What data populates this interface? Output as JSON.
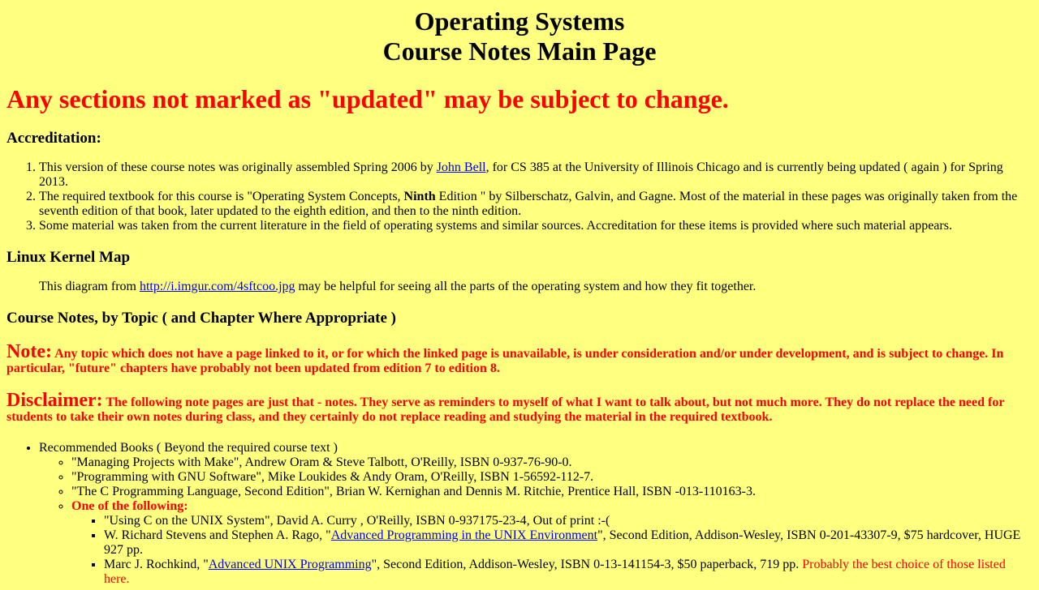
{
  "header": {
    "title_line1": "Operating Systems",
    "title_line2": "Course Notes Main Page"
  },
  "warning": "Any sections not marked as \"updated\" may be subject to change.",
  "accreditation": {
    "heading": "Accreditation:",
    "items": [
      {
        "text_before": "This version of these course notes was originally assembled Spring 2006 by ",
        "link": "John Bell",
        "text_after": ", for CS 385 at the University of Illinois Chicago and is currently being updated ( again ) for Spring 2013."
      },
      {
        "text_before": "The required textbook for this course is \"Operating System Concepts, ",
        "bold": "Ninth",
        "text_after": " Edition \" by Silberschatz, Galvin, and Gagne. Most of the material in these pages was originally taken from the seventh edition of that book, later updated to the eighth edition, and then to the ninth edition."
      },
      {
        "text": "Some material was taken from the current literature in the field of operating systems and similar sources. Accreditation for these items is provided where such material appears."
      }
    ]
  },
  "kernel_map": {
    "heading": "Linux Kernel Map",
    "text_before": "This diagram from ",
    "link": "http://i.imgur.com/4sftcoo.jpg",
    "text_after": " may be helpful for seeing all the parts of the operating system and how they fit together."
  },
  "course_notes": {
    "heading": "Course Notes, by Topic ( and Chapter Where Appropriate )"
  },
  "note": {
    "label": "Note:",
    "text": " Any topic which does not have a page linked to it, or for which the linked page is unavailable, is under consideration and/or under development, and is subject to change. In particular, \"future\" chapters have probably not been updated from edition 7 to edition 8."
  },
  "disclaimer": {
    "label": "Disclaimer:",
    "text": " The following note pages are just that - notes. They serve as reminders to myself of what I want to talk about, but not much more. They do not replace the need for students to take their own notes during class, and they certainly do not replace reading and studying the material in the required textbook."
  },
  "books": {
    "heading": "Recommended Books ( Beyond the required course text )",
    "items": [
      "\"Managing Projects with Make\", Andrew Oram & Steve Talbott, O'Reilly, ISBN 0-937-76-90-0.",
      "\"Programming with GNU Software\", Mike Loukides & Andy Oram, O'Reilly, ISBN 1-56592-112-7.",
      "\"The C Programming Language, Second Edition\", Brian W. Kernighan and Dennis M. Ritchie, Prentice Hall, ISBN -013-110163-3."
    ],
    "one_of_label": "One of the following:",
    "sub": {
      "item1": "\"Using C on the UNIX System\", David A. Curry , O'Reilly, ISBN 0-937175-23-4, Out of print :-(",
      "item2_before": "W. Richard Stevens and Stephen A. Rago, \"",
      "item2_link": "Advanced Programming in the UNIX Environment",
      "item2_after": "\", Second Edition, Addison-Wesley, ISBN 0-201-43307-9, $75 hardcover, HUGE 927 pp.",
      "item3_before": "Marc J. Rochkind, \"",
      "item3_link": "Advanced UNIX Programming",
      "item3_after": "\", Second Edition, Addison-Wesley, ISBN 0-13-141154-3, $50 paperback, 719 pp. ",
      "item3_red": "Probably the best choice of those listed here."
    }
  },
  "colors": {
    "background": "#ffff80",
    "warning_red": "#ff0000",
    "link_blue": "#0000ee"
  }
}
